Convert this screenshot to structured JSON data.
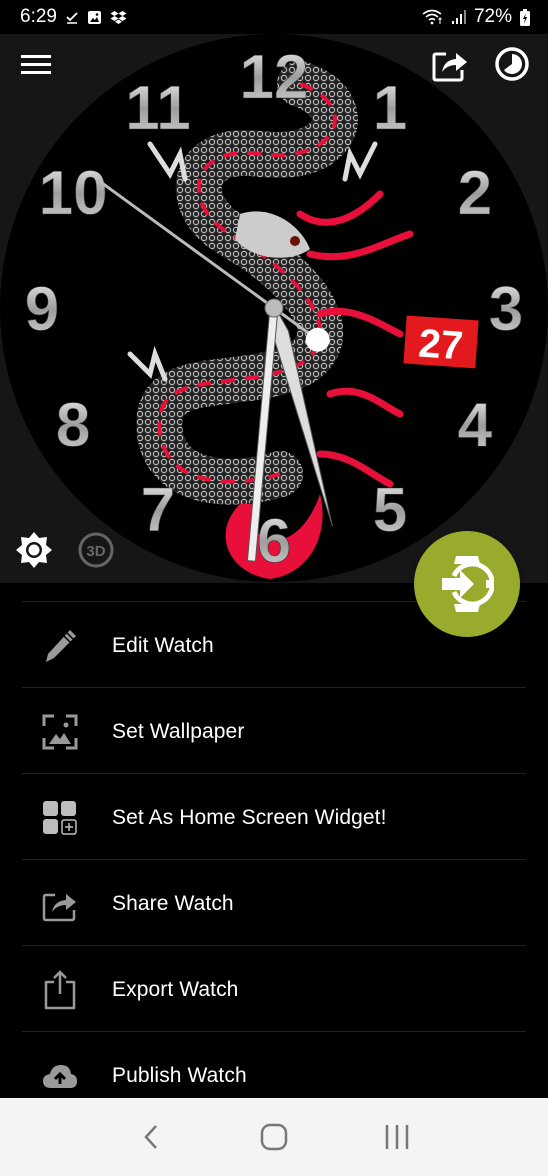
{
  "status_bar": {
    "time": "6:29",
    "left_icons": [
      "checkmark-icon",
      "image-icon",
      "dropbox-icon"
    ],
    "right_icons": [
      "wifi-icon",
      "signal-icon"
    ],
    "battery": "72%",
    "battery_icon": "battery-charging-icon"
  },
  "preview": {
    "menu_icon": "hamburger-menu-icon",
    "share_icon": "share-icon",
    "theme_icon": "theme-toggle-icon",
    "brightness_icon": "brightness-icon",
    "threed_label": "3D",
    "watch_face": {
      "numerals": [
        "12",
        "1",
        "2",
        "3",
        "4",
        "5",
        "6",
        "7",
        "8",
        "9",
        "10",
        "11"
      ],
      "date": "27",
      "date_color": "#e3191e",
      "accent_red": "#e8103a",
      "time_shown": {
        "hour": 5,
        "minute": 30,
        "second": 51
      }
    }
  },
  "fab": {
    "icon": "watch-sync-icon",
    "color": "#9aaa2c"
  },
  "menu": {
    "items": [
      {
        "label": "Edit Watch",
        "icon": "pencil-icon"
      },
      {
        "label": "Set Wallpaper",
        "icon": "wallpaper-icon"
      },
      {
        "label": "Set As Home Screen Widget!",
        "icon": "widget-add-icon"
      },
      {
        "label": "Share Watch",
        "icon": "share-icon"
      },
      {
        "label": "Export Watch",
        "icon": "export-icon"
      },
      {
        "label": "Publish Watch",
        "icon": "cloud-upload-icon"
      }
    ]
  },
  "nav_bar": {
    "back_icon": "back-icon",
    "home_icon": "home-icon",
    "recents_icon": "recents-icon"
  }
}
